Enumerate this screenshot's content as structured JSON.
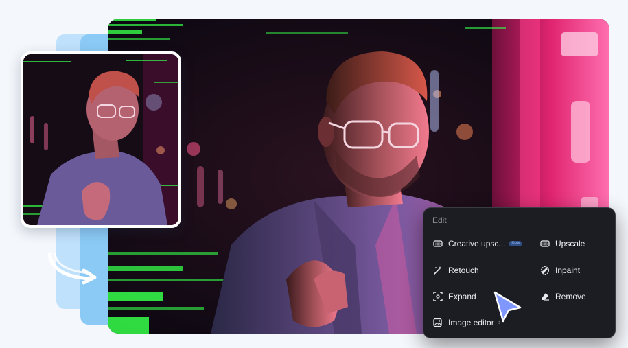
{
  "edit_panel": {
    "title": "Edit",
    "items": [
      {
        "label": "Creative upsc...",
        "badge": "New",
        "icon": "hd-upscale-icon"
      },
      {
        "label": "Upscale",
        "icon": "hd-icon"
      },
      {
        "label": "Retouch",
        "icon": "magic-wand-icon"
      },
      {
        "label": "Inpaint",
        "icon": "inpaint-brush-icon"
      },
      {
        "label": "Expand",
        "icon": "expand-icon"
      },
      {
        "label": "Remove",
        "icon": "eraser-icon"
      },
      {
        "label": "Image editor",
        "icon": "image-editor-icon",
        "chevron": "›"
      }
    ]
  },
  "colors": {
    "panel_bg": "#1c1d22",
    "accent_blue": "#7f97ff",
    "neon_pink": "#ff4fa3",
    "neon_green": "#36ff4a",
    "light_blue": "#8ccaf6"
  }
}
